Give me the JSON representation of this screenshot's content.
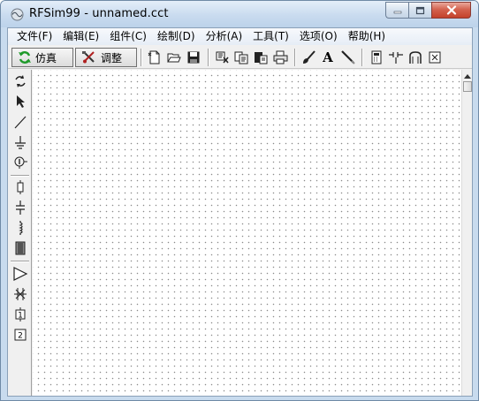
{
  "window": {
    "title": "RFSim99 - unnamed.cct"
  },
  "menu": [
    {
      "label": "文件(F)"
    },
    {
      "label": "编辑(E)"
    },
    {
      "label": "组件(C)"
    },
    {
      "label": "绘制(D)"
    },
    {
      "label": "分析(A)"
    },
    {
      "label": "工具(T)"
    },
    {
      "label": "选项(O)"
    },
    {
      "label": "帮助(H)"
    }
  ],
  "toolbar": {
    "simulate_label": "仿真",
    "tune_label": "调整",
    "icons": [
      "new-file-icon",
      "open-folder-icon",
      "save-icon",
      "cut-icon",
      "copy-icon",
      "paste-icon",
      "print-icon",
      "paint-brush-icon",
      "text-icon",
      "line-draw-icon",
      "calculator-icon",
      "component-icon",
      "coax-icon",
      "dimension-icon"
    ],
    "text_glyph": "A"
  },
  "leftbar": {
    "icons": [
      "rotate-icon",
      "pointer-icon",
      "wire-icon",
      "ground-icon",
      "port-icon",
      "resistor-icon",
      "capacitor-icon",
      "inductor-icon",
      "transformer-icon",
      "amplifier-icon",
      "transistor-icon",
      "one-port-icon",
      "two-port-icon"
    ],
    "port1_label": "1",
    "port2_label": "2"
  },
  "colors": {
    "title_gradient_top": "#e4eef9",
    "close_red": "#c3412b",
    "canvas_bg": "#ffffff",
    "grid_dot": "#8a8a8a"
  }
}
